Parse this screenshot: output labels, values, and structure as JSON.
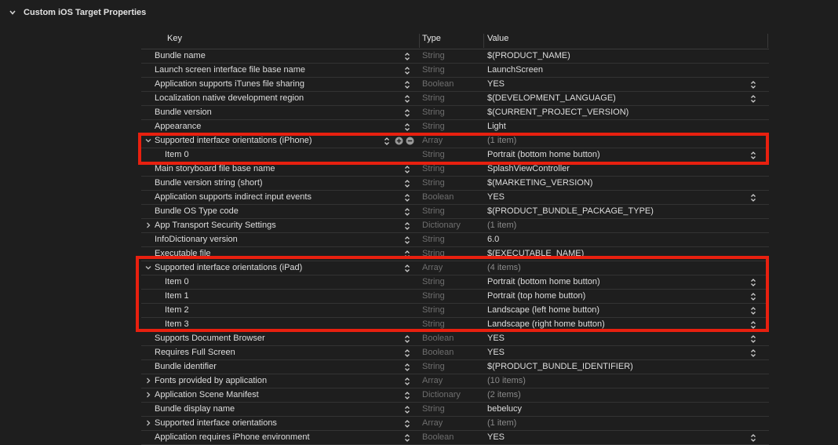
{
  "section": {
    "title": "Custom iOS Target Properties"
  },
  "columns": {
    "key": "Key",
    "type": "Type",
    "value": "Value"
  },
  "rows": [
    {
      "key": "Bundle name",
      "type": "String",
      "value": "$(PRODUCT_NAME)",
      "disc": "none",
      "valueStepper": false
    },
    {
      "key": "Launch screen interface file base name",
      "type": "String",
      "value": "LaunchScreen",
      "disc": "none",
      "valueStepper": false
    },
    {
      "key": "Application supports iTunes file sharing",
      "type": "Boolean",
      "value": "YES",
      "disc": "none",
      "valueStepper": true
    },
    {
      "key": "Localization native development region",
      "type": "String",
      "value": "$(DEVELOPMENT_LANGUAGE)",
      "disc": "none",
      "valueStepper": true
    },
    {
      "key": "Bundle version",
      "type": "String",
      "value": "$(CURRENT_PROJECT_VERSION)",
      "disc": "none",
      "valueStepper": false
    },
    {
      "key": "Appearance",
      "type": "String",
      "value": "Light",
      "disc": "none",
      "valueStepper": false
    },
    {
      "key": "Supported interface orientations (iPhone)",
      "type": "Array",
      "value": "(1 item)",
      "disc": "open",
      "valueStepper": false,
      "dim": true,
      "addRemove": true
    },
    {
      "key": "Item 0",
      "type": "String",
      "value": "Portrait (bottom home button)",
      "disc": "none",
      "child": true,
      "keyStepper": false,
      "valueStepper": true
    },
    {
      "key": "Main storyboard file base name",
      "type": "String",
      "value": "SplashViewController",
      "disc": "none",
      "valueStepper": false
    },
    {
      "key": "Bundle version string (short)",
      "type": "String",
      "value": "$(MARKETING_VERSION)",
      "disc": "none",
      "valueStepper": false
    },
    {
      "key": "Application supports indirect input events",
      "type": "Boolean",
      "value": "YES",
      "disc": "none",
      "valueStepper": true
    },
    {
      "key": "Bundle OS Type code",
      "type": "String",
      "value": "$(PRODUCT_BUNDLE_PACKAGE_TYPE)",
      "disc": "none",
      "valueStepper": false
    },
    {
      "key": "App Transport Security Settings",
      "type": "Dictionary",
      "value": "(1 item)",
      "disc": "closed",
      "valueStepper": false,
      "dim": true
    },
    {
      "key": "InfoDictionary version",
      "type": "String",
      "value": "6.0",
      "disc": "none",
      "valueStepper": false
    },
    {
      "key": "Executable file",
      "type": "String",
      "value": "$(EXECUTABLE_NAME)",
      "disc": "none",
      "valueStepper": false
    },
    {
      "key": "Supported interface orientations (iPad)",
      "type": "Array",
      "value": "(4 items)",
      "disc": "open",
      "valueStepper": false,
      "dim": true
    },
    {
      "key": "Item 0",
      "type": "String",
      "value": "Portrait (bottom home button)",
      "disc": "none",
      "child": true,
      "keyStepper": false,
      "valueStepper": true
    },
    {
      "key": "Item 1",
      "type": "String",
      "value": "Portrait (top home button)",
      "disc": "none",
      "child": true,
      "keyStepper": false,
      "valueStepper": true
    },
    {
      "key": "Item 2",
      "type": "String",
      "value": "Landscape (left home button)",
      "disc": "none",
      "child": true,
      "keyStepper": false,
      "valueStepper": true
    },
    {
      "key": "Item 3",
      "type": "String",
      "value": "Landscape (right home button)",
      "disc": "none",
      "child": true,
      "keyStepper": false,
      "valueStepper": true
    },
    {
      "key": "Supports Document Browser",
      "type": "Boolean",
      "value": "YES",
      "disc": "none",
      "valueStepper": true
    },
    {
      "key": "Requires Full Screen",
      "type": "Boolean",
      "value": "YES",
      "disc": "none",
      "valueStepper": true
    },
    {
      "key": "Bundle identifier",
      "type": "String",
      "value": "$(PRODUCT_BUNDLE_IDENTIFIER)",
      "disc": "none",
      "valueStepper": false
    },
    {
      "key": "Fonts provided by application",
      "type": "Array",
      "value": "(10 items)",
      "disc": "closed",
      "valueStepper": false,
      "dim": true
    },
    {
      "key": "Application Scene Manifest",
      "type": "Dictionary",
      "value": "(2 items)",
      "disc": "closed",
      "valueStepper": false,
      "dim": true
    },
    {
      "key": "Bundle display name",
      "type": "String",
      "value": "bebelucy",
      "disc": "none",
      "valueStepper": false
    },
    {
      "key": "Supported interface orientations",
      "type": "Array",
      "value": "(1 item)",
      "disc": "closed",
      "valueStepper": false,
      "dim": true
    },
    {
      "key": "Application requires iPhone environment",
      "type": "Boolean",
      "value": "YES",
      "disc": "none",
      "valueStepper": true
    }
  ],
  "colors": {
    "highlight": "#e8200f",
    "background": "#1e1e1e"
  }
}
